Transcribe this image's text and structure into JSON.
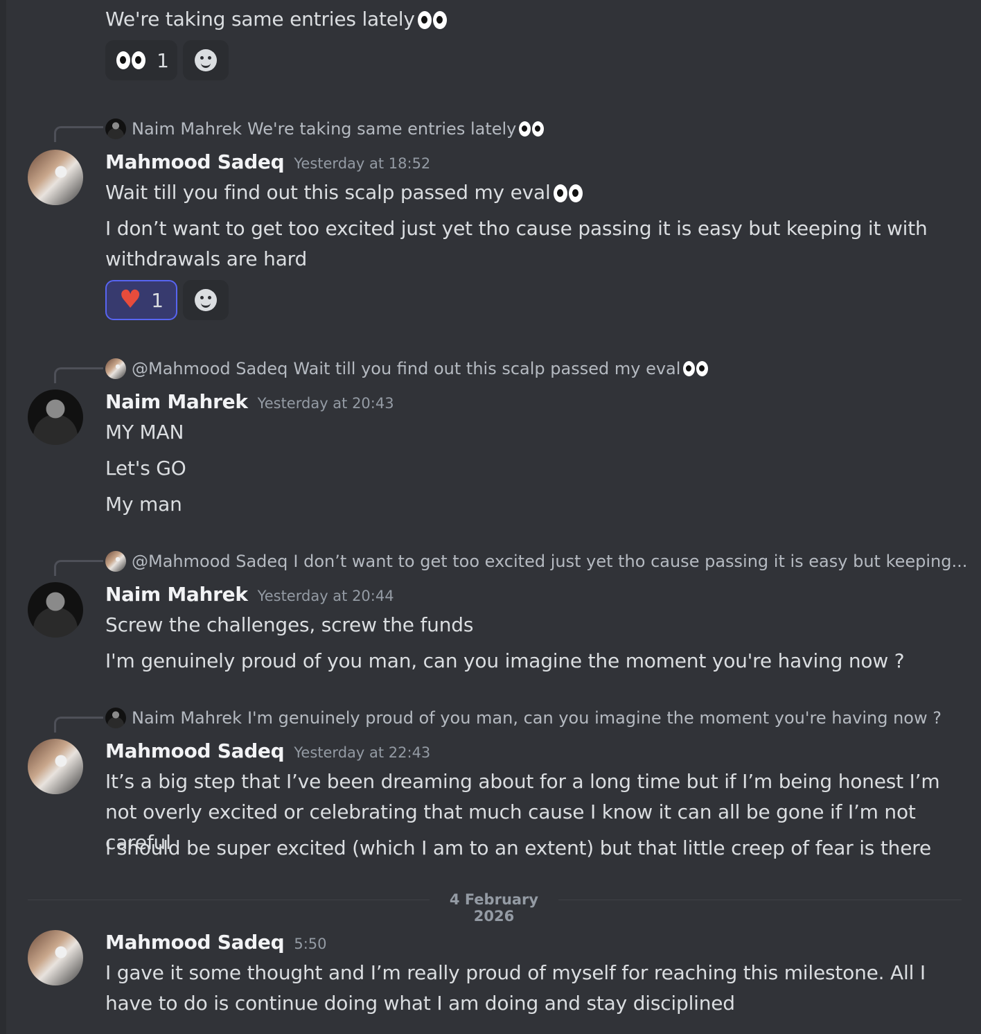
{
  "messages": {
    "m0": {
      "line1": "We're taking same entries lately",
      "reaction_count": "1"
    },
    "m1": {
      "reply_author": "Naim Mahrek",
      "reply_text": "We're taking same entries lately",
      "author": "Mahmood Sadeq",
      "timestamp": "Yesterday at 18:52",
      "line1": "Wait till you find out this scalp passed my eval",
      "line2": "I don’t want to get too excited just yet tho cause passing it is easy but keeping it with withdrawals are hard",
      "reaction_count": "1"
    },
    "m2": {
      "reply_author": "@Mahmood Sadeq",
      "reply_text": "Wait till you find out this scalp passed my eval",
      "author": "Naim Mahrek",
      "timestamp": "Yesterday at 20:43",
      "line1": "MY MAN",
      "line2": "Let's GO",
      "line3": "My man"
    },
    "m3": {
      "reply_author": "@Mahmood Sadeq",
      "reply_text": "I don’t want to get too excited just yet tho cause passing it is easy but keeping...",
      "author": "Naim Mahrek",
      "timestamp": "Yesterday at 20:44",
      "line1": "Screw the challenges, screw the funds",
      "line2": "I'm genuinely proud of you man, can you imagine the moment you're having now ?"
    },
    "m4": {
      "reply_author": "Naim Mahrek",
      "reply_text": "I'm genuinely proud of you man, can you imagine the moment you're having now ?",
      "author": "Mahmood Sadeq",
      "timestamp": "Yesterday at 22:43",
      "line1": "It’s a big step that I’ve been dreaming about for a long time but if I’m being honest I’m not overly excited or celebrating that much cause I know it can all be gone if I’m not careful",
      "line2": "I should be super excited (which I am to an extent) but that little creep of fear is there"
    },
    "m5": {
      "author": "Mahmood Sadeq",
      "timestamp": "5:50",
      "line1": "I gave it some thought and I’m really proud of myself for reaching this milestone. All I have to do is continue doing what I am doing and stay disciplined"
    }
  },
  "date_divider": "4 February 2026",
  "icons": {
    "eyes": "eyes-emoji",
    "heart": "heart-emoji",
    "add_reaction": "add-reaction-icon"
  },
  "colors": {
    "background": "#313338",
    "reaction_active": "#5865f2"
  }
}
